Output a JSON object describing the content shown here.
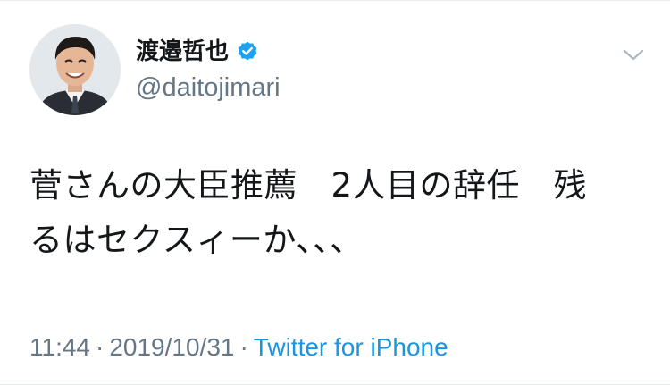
{
  "user": {
    "display_name": "渡邉哲也",
    "handle": "@daitojimari",
    "verified": true
  },
  "tweet": {
    "text_lines": [
      "菅さんの大臣推薦　2人目の辞任　残",
      "るはセクスィーか、、、"
    ],
    "time": "11:44",
    "separator": "·",
    "date": "2019/10/31",
    "source": "Twitter for iPhone"
  },
  "icons": {
    "verified": "verified-badge-icon",
    "menu": "chevron-down-icon"
  },
  "colors": {
    "text": "#14171a",
    "secondary": "#657786",
    "link": "#1b95e0",
    "verified_badge": "#1da1f2",
    "border": "#e6ecf0"
  }
}
